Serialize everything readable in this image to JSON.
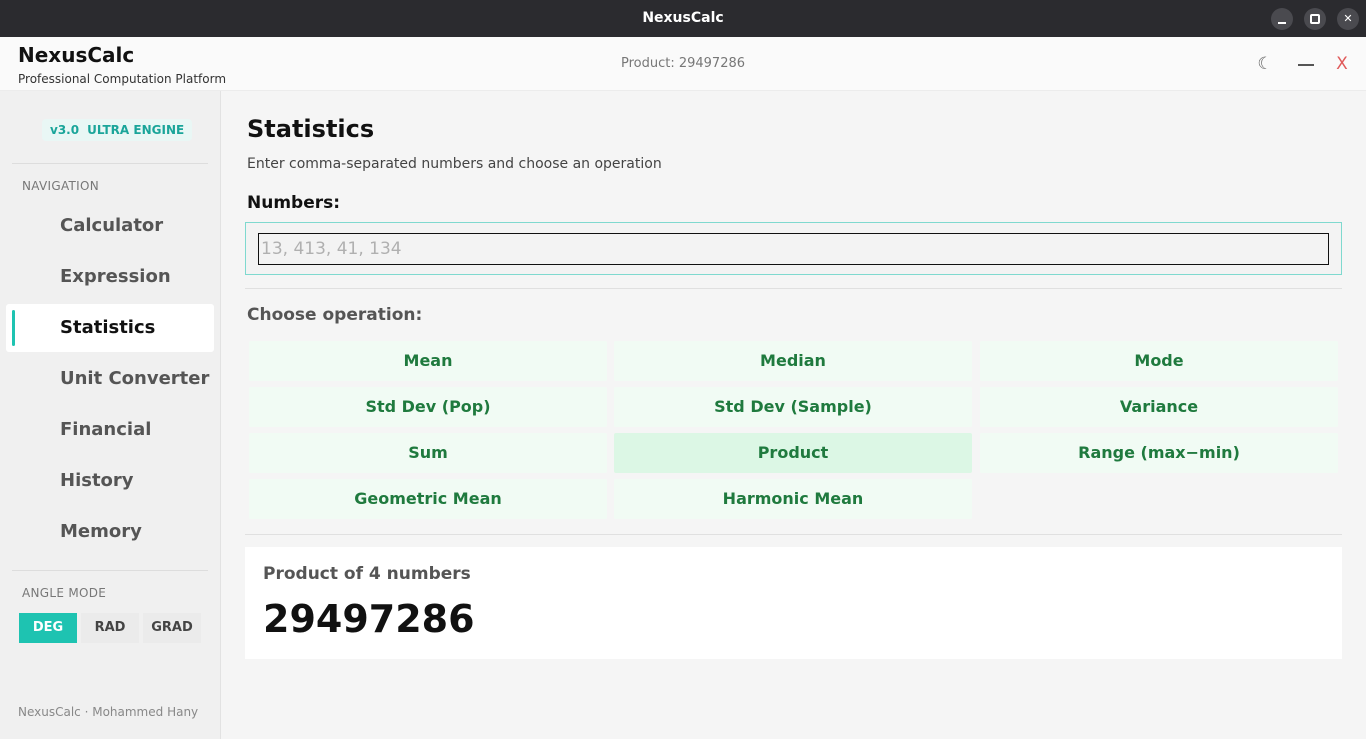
{
  "window": {
    "title": "NexusCalc"
  },
  "header": {
    "brand": "NexusCalc",
    "subtitle": "Professional Computation Platform",
    "status": "Product: 29497286",
    "close_glyph": "X"
  },
  "sidebar": {
    "version": "v3.0",
    "engine": "ULTRA ENGINE",
    "nav_label": "NAVIGATION",
    "items": [
      {
        "label": "Calculator",
        "active": false
      },
      {
        "label": "Expression",
        "active": false
      },
      {
        "label": "Statistics",
        "active": true
      },
      {
        "label": "Unit Converter",
        "active": false
      },
      {
        "label": "Financial",
        "active": false
      },
      {
        "label": "History",
        "active": false
      },
      {
        "label": "Memory",
        "active": false
      }
    ],
    "angle_label": "ANGLE MODE",
    "angle_modes": [
      "DEG",
      "RAD",
      "GRAD"
    ],
    "angle_selected": "DEG",
    "footer": "NexusCalc · Mohammed Hany"
  },
  "main": {
    "title": "Statistics",
    "subtitle": "Enter comma-separated numbers and choose an operation",
    "numbers_label": "Numbers:",
    "numbers_placeholder": "13, 413, 41, 134",
    "numbers_value": "",
    "choose_label": "Choose operation:",
    "operations": [
      "Mean",
      "Median",
      "Mode",
      "Std Dev (Pop)",
      "Std Dev (Sample)",
      "Variance",
      "Sum",
      "Product",
      "Range (max−min)",
      "Geometric Mean",
      "Harmonic Mean"
    ],
    "active_operation": "Product",
    "result": {
      "label": "Product of 4 numbers",
      "value": "29497286"
    }
  },
  "colors": {
    "accent": "#1ec3b1",
    "op_text": "#1f7a3e",
    "op_bg": "#f1fbf4",
    "op_active_bg": "#dcf7e5",
    "titlebar": "#2b2b2f"
  }
}
